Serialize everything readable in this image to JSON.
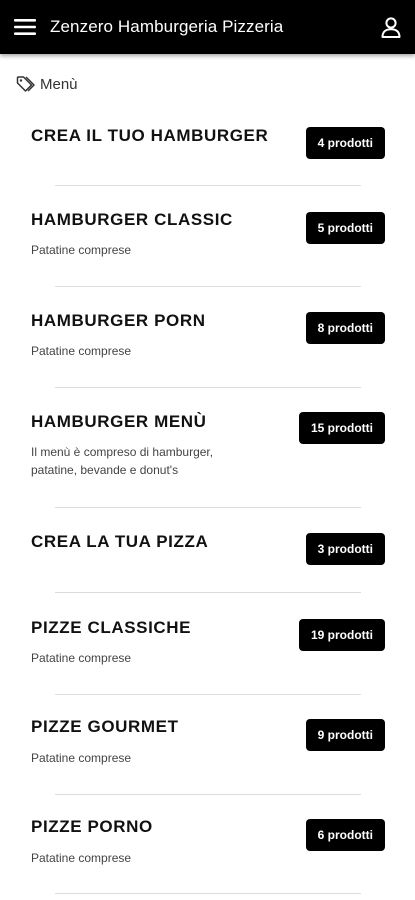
{
  "appbar": {
    "title": "Zenzero Hamburgeria Pizzeria",
    "menu_icon": "hamburger-menu-icon",
    "user_icon": "user-icon"
  },
  "breadcrumb": {
    "icon": "tag-icon",
    "label": "Menù"
  },
  "categories": [
    {
      "name": "CREA IL TUO HAMBURGER",
      "description": "",
      "count": "4 prodotti"
    },
    {
      "name": "HAMBURGER CLASSIC",
      "description": "Patatine comprese",
      "count": "5 prodotti"
    },
    {
      "name": "HAMBURGER PORN",
      "description": "Patatine comprese",
      "count": "8 prodotti"
    },
    {
      "name": "HAMBURGER MENÙ",
      "description": "Il menù è compreso di hamburger, patatine, bevande e donut's",
      "count": "15 prodotti"
    },
    {
      "name": "CREA LA TUA PIZZA",
      "description": "",
      "count": "3 prodotti"
    },
    {
      "name": "PIZZE CLASSICHE",
      "description": "Patatine comprese",
      "count": "19 prodotti"
    },
    {
      "name": "PIZZE GOURMET",
      "description": "Patatine comprese",
      "count": "9 prodotti"
    },
    {
      "name": "PIZZE PORNO",
      "description": "Patatine comprese",
      "count": "6 prodotti"
    }
  ],
  "colors": {
    "appbar": "#000000",
    "badge": "#000000",
    "divider": "#dcdcdc"
  }
}
